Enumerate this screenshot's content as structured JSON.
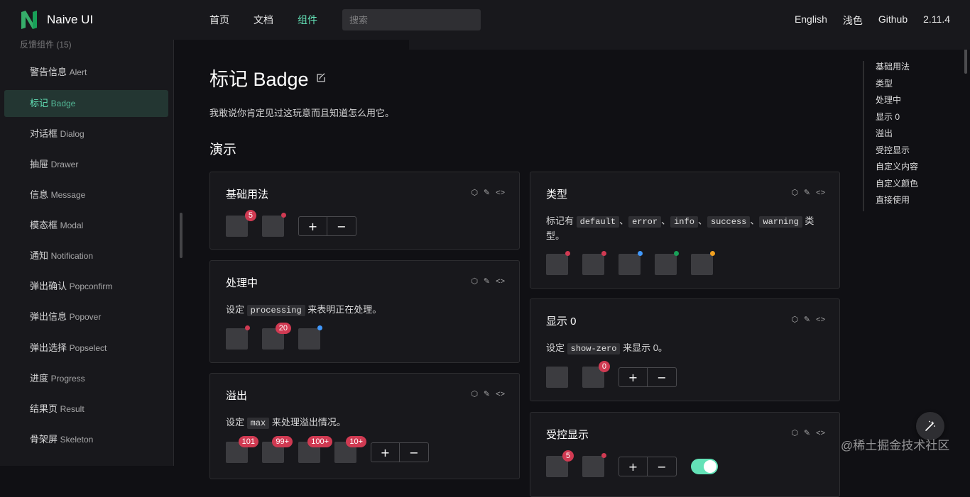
{
  "header": {
    "logo_text": "Naive UI",
    "nav": [
      "首页",
      "文档",
      "组件"
    ],
    "search_placeholder": "搜索",
    "right": [
      "English",
      "浅色",
      "Github",
      "2.11.4"
    ],
    "accent": "#63e2b7"
  },
  "sidebar": {
    "group": "反馈组件 (15)",
    "items": [
      {
        "cn": "警告信息",
        "en": "Alert"
      },
      {
        "cn": "标记",
        "en": "Badge"
      },
      {
        "cn": "对话框",
        "en": "Dialog"
      },
      {
        "cn": "抽屉",
        "en": "Drawer"
      },
      {
        "cn": "信息",
        "en": "Message"
      },
      {
        "cn": "模态框",
        "en": "Modal"
      },
      {
        "cn": "通知",
        "en": "Notification"
      },
      {
        "cn": "弹出确认",
        "en": "Popconfirm"
      },
      {
        "cn": "弹出信息",
        "en": "Popover"
      },
      {
        "cn": "弹出选择",
        "en": "Popselect"
      },
      {
        "cn": "进度",
        "en": "Progress"
      },
      {
        "cn": "结果页",
        "en": "Result"
      },
      {
        "cn": "骨架屏",
        "en": "Skeleton"
      }
    ]
  },
  "page": {
    "title": "标记 Badge",
    "desc": "我敢说你肯定见过这玩意而且知道怎么用它。",
    "section": "演示"
  },
  "cards": {
    "basic": {
      "title": "基础用法",
      "badge": "5",
      "plus": "+",
      "minus": "−"
    },
    "processing": {
      "title": "处理中",
      "pre": "设定",
      "code": "processing",
      "post": "来表明正在处理。",
      "badge": "20"
    },
    "overflow": {
      "title": "溢出",
      "pre": "设定",
      "code": "max",
      "post": "来处理溢出情况。",
      "badges": [
        "101",
        "99+",
        "100+",
        "10+"
      ],
      "plus": "+",
      "minus": "−"
    },
    "types": {
      "title": "类型",
      "pre": "标记有",
      "codes": [
        "default",
        "error",
        "info",
        "success",
        "warning"
      ],
      "sep": "、",
      "post": "类型。"
    },
    "show_zero": {
      "title": "显示 0",
      "pre": "设定",
      "code": "show-zero",
      "post": "来显示 0。",
      "badge": "0",
      "plus": "+",
      "minus": "−"
    },
    "controlled": {
      "title": "受控显示",
      "badge": "5",
      "plus": "+",
      "minus": "−"
    }
  },
  "card_tools": [
    "⬡",
    "✎",
    "<>"
  ],
  "toc": [
    "基础用法",
    "类型",
    "处理中",
    "显示 0",
    "溢出",
    "受控显示",
    "自定义内容",
    "自定义颜色",
    "直接使用"
  ],
  "type_colors": [
    "#d03a52",
    "#d03a52",
    "#4098fc",
    "#18a058",
    "#f0a020"
  ],
  "watermark": "@稀土掘金技术社区"
}
